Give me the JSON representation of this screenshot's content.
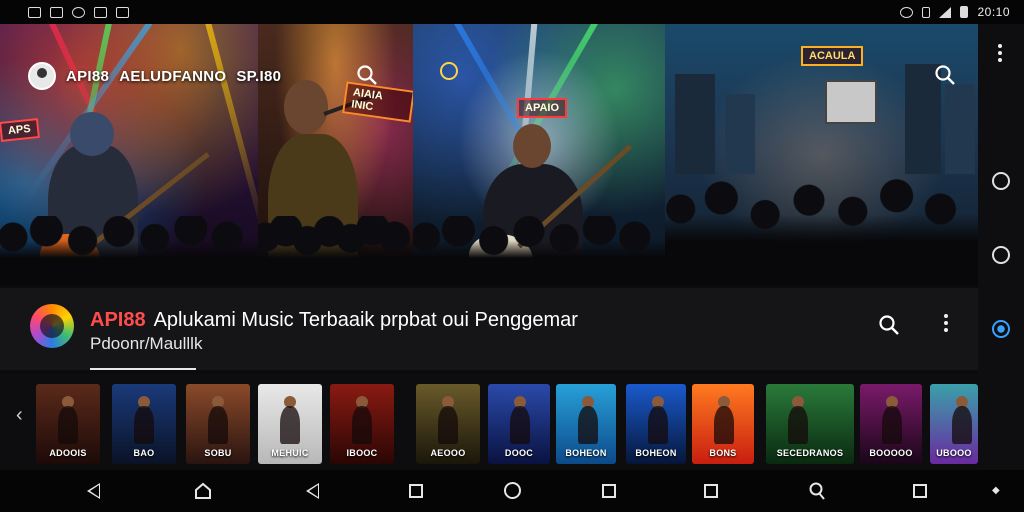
{
  "status_bar": {
    "time": "20:10",
    "left_icons": [
      "notification-icon",
      "image-icon",
      "settings-icon",
      "video-icon",
      "mail-icon"
    ],
    "right_icons": [
      "alarm-icon",
      "bluetooth-icon",
      "signal-icon",
      "battery-icon"
    ]
  },
  "hero": {
    "title_brand": "API88",
    "title_text": "AELUDFANNO",
    "title_extra": "SP.I80",
    "sign_left": "APS",
    "sign_mid": "AIAIA INIC",
    "sign_center": "APAIO",
    "sign_right": "ACAULA"
  },
  "info": {
    "brand": "API88",
    "title": "Aplukami Music Terbaaik prpbat oui Penggemar",
    "subtitle": "Pdoonr/Maulllk"
  },
  "thumbnails": [
    {
      "label": "ADOOIS",
      "color_a": "#5a2a1a",
      "color_b": "#1d0a08"
    },
    {
      "label": "BAO",
      "color_a": "#1a3a7a",
      "color_b": "#0a1226"
    },
    {
      "label": "SOBU",
      "color_a": "#8a4a2a",
      "color_b": "#2a1410"
    },
    {
      "label": "MEHUIC",
      "color_a": "#e8e8e8",
      "color_b": "#b8b8b8"
    },
    {
      "label": "IBOOC",
      "color_a": "#8a1a12",
      "color_b": "#2a0604"
    },
    {
      "label": "AEOOO",
      "color_a": "#6a5a2a",
      "color_b": "#1a160a"
    },
    {
      "label": "DOOC",
      "color_a": "#2a4aaa",
      "color_b": "#0a1240"
    },
    {
      "label": "BOHEON",
      "color_a": "#28a0d8",
      "color_b": "#0c4a8a"
    },
    {
      "label": "BOHEON",
      "color_a": "#1a5acc",
      "color_b": "#06163a"
    },
    {
      "label": "BONS",
      "color_a": "#ff7a20",
      "color_b": "#c81e10"
    },
    {
      "label": "SECEDRANOS",
      "color_a": "#2a7a3a",
      "color_b": "#0a2a10"
    },
    {
      "label": "BOOOOO",
      "color_a": "#7a1a6a",
      "color_b": "#1a0618"
    },
    {
      "label": "UBOOO",
      "color_a": "#3aa0aa",
      "color_b": "#6a2aa0"
    }
  ]
}
